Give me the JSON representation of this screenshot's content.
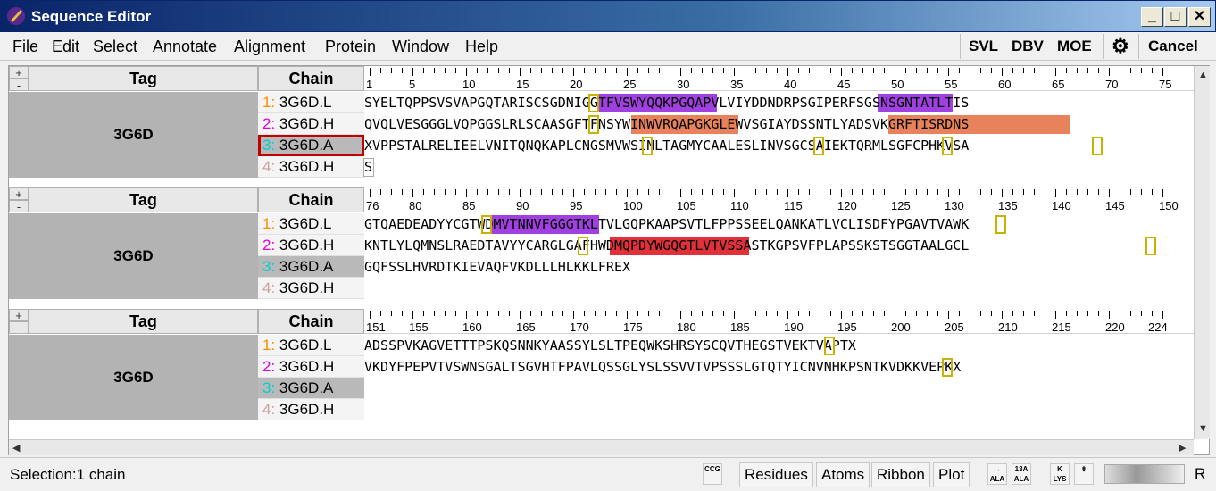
{
  "window": {
    "title": "Sequence Editor"
  },
  "menu": {
    "file": "File",
    "edit": "Edit",
    "select": "Select",
    "annotate": "Annotate",
    "alignment": "Alignment",
    "protein": "Protein",
    "window": "Window",
    "help": "Help",
    "svl": "SVL",
    "dbv": "DBV",
    "moe": "MOE",
    "cancel": "Cancel"
  },
  "headers": {
    "tag": "Tag",
    "chain": "Chain",
    "plus": "+",
    "minus": "-"
  },
  "blocks": [
    {
      "tag": "3G6D",
      "chains": [
        {
          "num": "1:",
          "name": "3G6D.L",
          "color": "#ff8c00"
        },
        {
          "num": "2:",
          "name": "3G6D.H",
          "color": "#e000e0"
        },
        {
          "num": "3:",
          "name": "3G6D.A",
          "color": "#00d0d0"
        },
        {
          "num": "4:",
          "name": "3G6D.H",
          "color": "#d0a0a0"
        }
      ],
      "ruler_start": 1,
      "ruler_labels": [
        "1",
        "5",
        "10",
        "15",
        "20",
        "25",
        "30",
        "35",
        "40",
        "45",
        "50",
        "55",
        "60",
        "65",
        "70",
        "75"
      ],
      "sequences": [
        "SYELTQPPSVSVAPGQTARISCSGDNIGGTFVSWYQQKPGQAPVLVIYDDNDRPSGIPERFSGSNSGNTATLTIS",
        "QVQLVESGGGLVQPGGSLRLSCAASGFTFNSYWINWVRQAPGKGLEWVSGIAYDSSNTLYADSVKGRFTISRDNS",
        "XVPPSTALRELIEELVNITQNQKAPLCNGSMVWSINLTAGMYCAALESLINVSGCSAIEKTQRMLSGFCPHKVSA",
        "S"
      ]
    },
    {
      "tag": "3G6D",
      "chains": [
        {
          "num": "1:",
          "name": "3G6D.L",
          "color": "#ff8c00"
        },
        {
          "num": "2:",
          "name": "3G6D.H",
          "color": "#e000e0"
        },
        {
          "num": "3:",
          "name": "3G6D.A",
          "color": "#00d0d0"
        },
        {
          "num": "4:",
          "name": "3G6D.H",
          "color": "#d0a0a0"
        }
      ],
      "ruler_start": 76,
      "ruler_labels": [
        "76",
        "80",
        "85",
        "90",
        "95",
        "100",
        "105",
        "110",
        "115",
        "120",
        "125",
        "130",
        "135",
        "140",
        "145",
        "150"
      ],
      "sequences": [
        "GTQAEDEADYYCGTWDMVTNNVFGGGTKLTVLGQPKAAPSVTLFPPSSEELQANKATLVCLISDFYPGAVTVAWK",
        "KNTLYLQMNSLRAEDTAVYYCARGLGAFHWDMQPDYWGQGTLVTVSSASTKGPSVFPLAPSSKSTSGGTAALGCL",
        "GQFSSLHVRDTKIEVAQFVKDLLLHLKKLFREX",
        ""
      ]
    },
    {
      "tag": "3G6D",
      "chains": [
        {
          "num": "1:",
          "name": "3G6D.L",
          "color": "#ff8c00"
        },
        {
          "num": "2:",
          "name": "3G6D.H",
          "color": "#e000e0"
        },
        {
          "num": "3:",
          "name": "3G6D.A",
          "color": "#00d0d0"
        },
        {
          "num": "4:",
          "name": "3G6D.H",
          "color": "#d0a0a0"
        }
      ],
      "ruler_start": 151,
      "ruler_labels": [
        "151",
        "155",
        "160",
        "165",
        "170",
        "175",
        "180",
        "185",
        "190",
        "195",
        "200",
        "205",
        "210",
        "215",
        "220",
        "224"
      ],
      "sequences": [
        "ADSSPVKAGVETTTPSKQSNNKYAASSYLSLTPEQWKSHRSYSCQVTHEGSTVEKTVAPTX",
        "VKDYFPEPVTVSWNSGALTSGVHTFPAVLQSSGLYSLSSVVTVPSSSLGTQTYICNVNHKPSNTKVDKKVEPKX",
        "",
        ""
      ]
    }
  ],
  "highlights": {
    "purple": "#a040e0",
    "salmon": "#e8825a",
    "red": "#e0303a",
    "cys_box": "#c8b400"
  },
  "status": {
    "selection": "Selection:1 chain",
    "residues": "Residues",
    "atoms": "Atoms",
    "ribbon": "Ribbon",
    "plot": "Plot",
    "r": "R"
  }
}
